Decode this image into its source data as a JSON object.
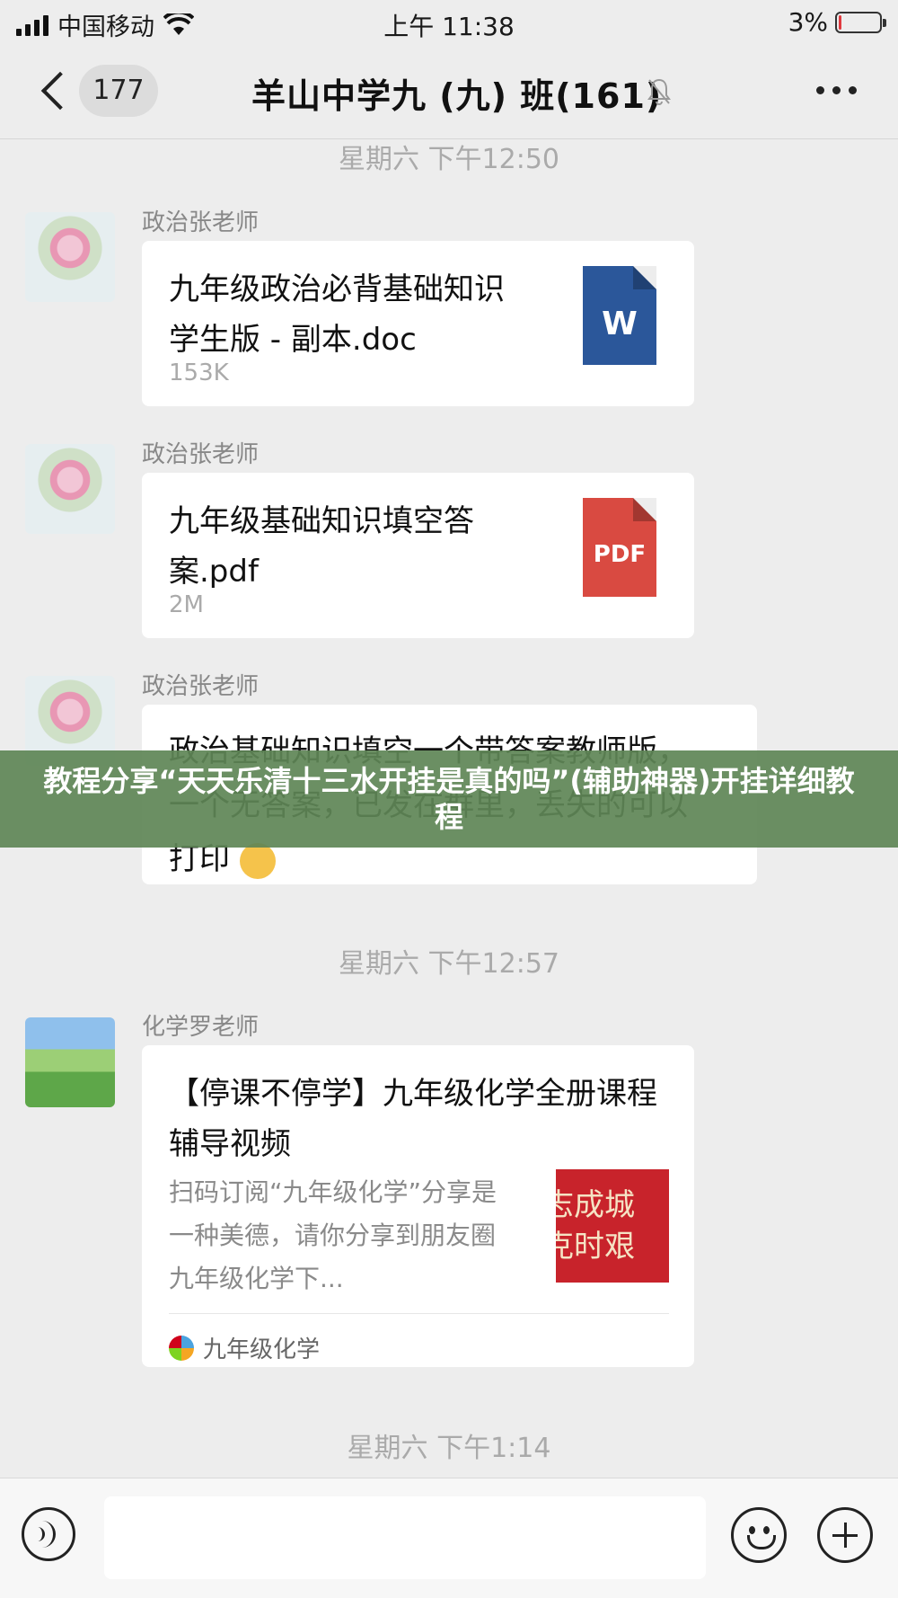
{
  "status_bar": {
    "carrier": "中国移动",
    "time": "上午 11:38",
    "battery_text": "3%",
    "battery_level": 0.03
  },
  "nav": {
    "unread_count": "177",
    "title": "羊山中学九 (九) 班(161)",
    "back_icon": "chevron-left-icon",
    "mute_icon": "bell-muted-icon",
    "more_icon": "more-dots-icon"
  },
  "timestamps": [
    "星期六 下午12:50",
    "星期六 下午12:57",
    "星期六 下午1:14"
  ],
  "messages": [
    {
      "sender": "政治张老师",
      "type": "file",
      "file_name": "九年级政治必背基础知识学生版 - 副本.doc",
      "file_size": "153K",
      "icon_label": "W"
    },
    {
      "sender": "政治张老师",
      "type": "file",
      "file_name": "九年级基础知识填空答案.pdf",
      "file_size": "2M",
      "icon_label": "PDF"
    },
    {
      "sender": "政治张老师",
      "type": "text",
      "text": "政治基础知识填空一个带答案教师版，一个无答案，已发在群里，丢失的可以打印"
    },
    {
      "sender": "化学罗老师",
      "type": "link",
      "title": "【停课不停学】九年级化学全册课程辅导视频",
      "description": "扫码订阅“九年级化学”分享是一种美德，请你分享到朋友圈九年级化学下...",
      "thumb_line1": "志成城",
      "thumb_line2": "克时艰",
      "source": "九年级化学"
    }
  ],
  "banner": {
    "text": "教程分享“天天乐清十三水开挂是真的吗”(辅助神器)开挂详细教程"
  },
  "input_bar": {
    "voice_icon": "voice-icon",
    "emoji_icon": "emoji-icon",
    "plus_icon": "plus-icon"
  }
}
